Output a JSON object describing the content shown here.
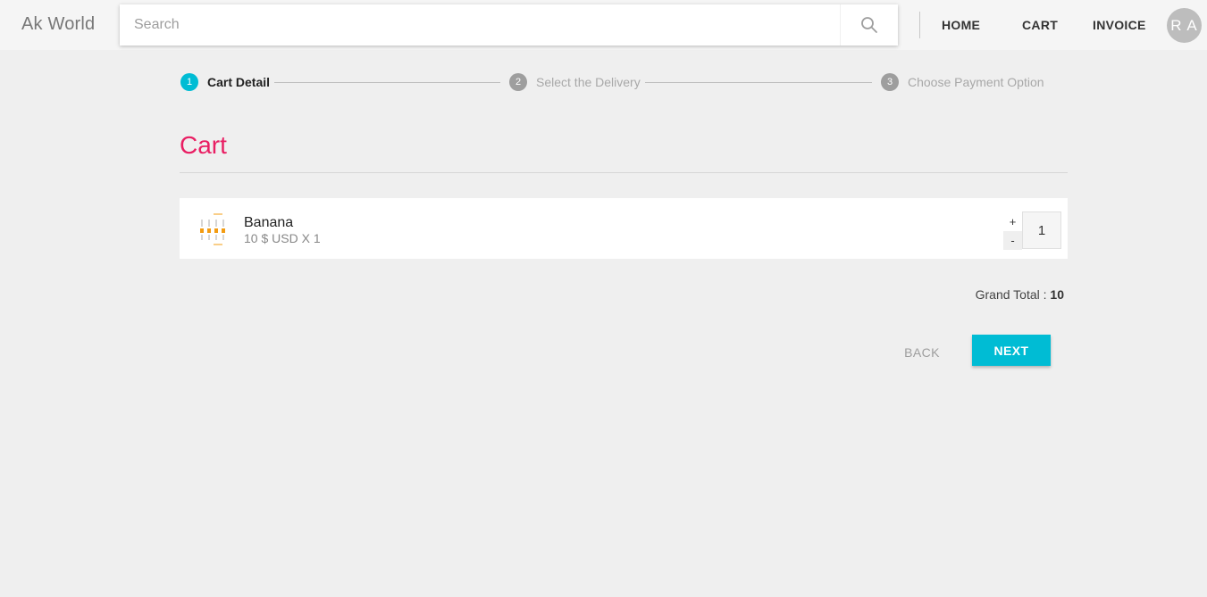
{
  "header": {
    "brand": "Ak World",
    "search_placeholder": "Search",
    "nav": {
      "home": "HOME",
      "cart": "CART",
      "invoice": "INVOICE"
    },
    "avatar_initials": "R A"
  },
  "stepper": {
    "steps": [
      {
        "number": "1",
        "label": "Cart Detail",
        "active": true
      },
      {
        "number": "2",
        "label": "Select the Delivery",
        "active": false
      },
      {
        "number": "3",
        "label": "Choose Payment Option",
        "active": false
      }
    ]
  },
  "cart": {
    "title": "Cart",
    "items": [
      {
        "name": "Banana",
        "price_line": "10 $ USD X 1",
        "quantity": "1",
        "plus_label": "+",
        "minus_label": "-",
        "thumbnail_icon": "product-thumbnail-icon"
      }
    ],
    "grand_total_label": "Grand Total :",
    "grand_total_value": "10"
  },
  "actions": {
    "back_label": "BACK",
    "next_label": "NEXT"
  },
  "colors": {
    "accent": "#00bcd4",
    "title": "#e91e63",
    "background": "#efefef"
  }
}
